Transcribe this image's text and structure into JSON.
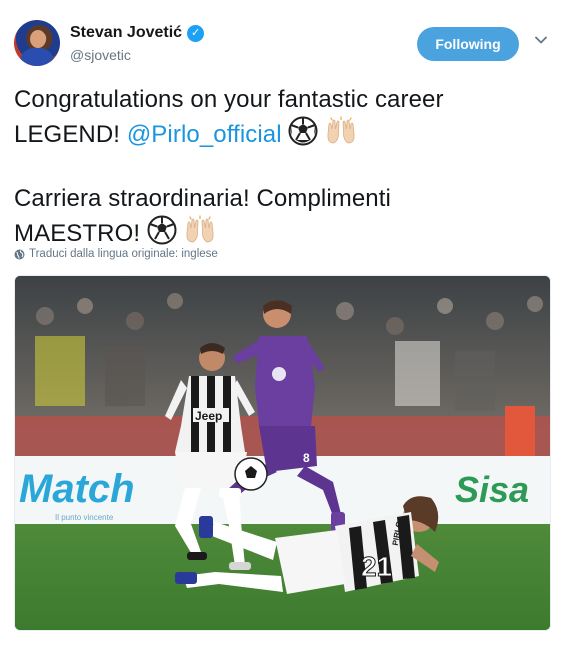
{
  "author": {
    "display_name": "Stevan Jovetić",
    "handle": "@sjovetic",
    "verified": true
  },
  "follow_button": {
    "label": "Following"
  },
  "tweet": {
    "line1": "Congratulations on your fantastic career",
    "line2_text": "LEGEND! ",
    "line2_mention": "@Pirlo_official",
    "line3": "Carriera straordinaria! Complimenti",
    "line4_text": "MAESTRO! "
  },
  "translate_note": "Traduci dalla lingua originale: inglese",
  "photo": {
    "ad_board_left": "Match",
    "ad_board_left_sub": "Il punto vincente",
    "ad_board_right": "Sisa",
    "jersey_sponsor": "Jeep",
    "jersey_name": "PIRLO",
    "jersey_number": "21",
    "number_front": "8"
  },
  "icons": {
    "verified": "verified-check-icon",
    "caret": "chevron-down-icon",
    "soccer": "soccer-ball-emoji",
    "raised_hands": "raised-hands-emoji",
    "globe": "globe-icon"
  },
  "colors": {
    "mention": "#1b95e0",
    "follow_button": "#4aa3df",
    "verified": "#1da1f2",
    "secondary_text": "#657786"
  }
}
